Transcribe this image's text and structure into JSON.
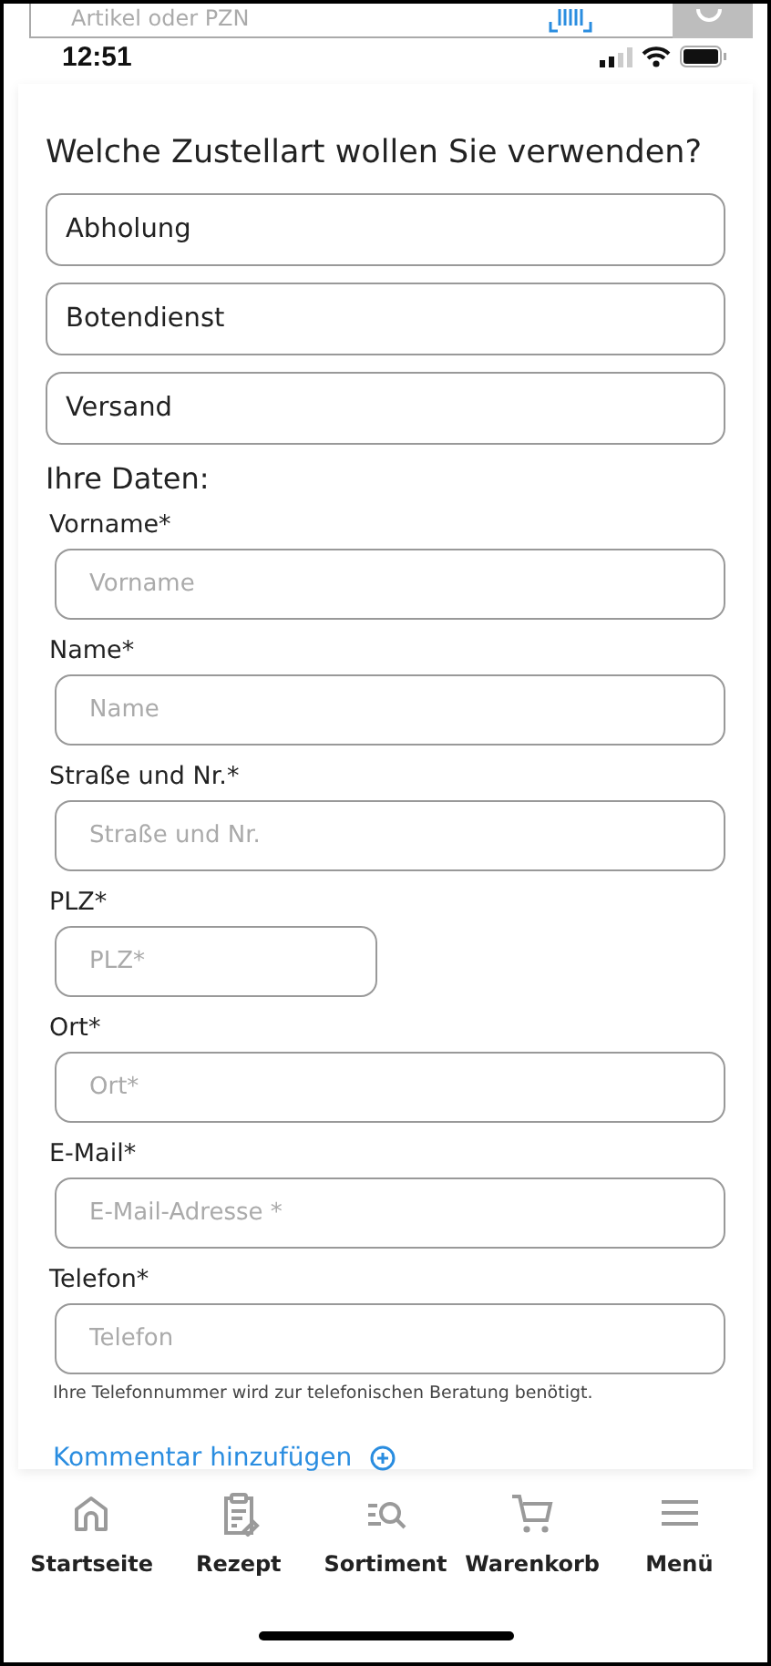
{
  "search": {
    "placeholder": "Artikel oder PZN"
  },
  "status_bar": {
    "time": "12:51"
  },
  "question": "Welche Zustellart wollen Sie verwenden?",
  "delivery_options": [
    {
      "label": "Abholung"
    },
    {
      "label": "Botendienst"
    },
    {
      "label": "Versand"
    }
  ],
  "section_title": "Ihre Daten:",
  "fields": [
    {
      "label": "Vorname*",
      "placeholder": "Vorname",
      "kind": "full"
    },
    {
      "label": "Name*",
      "placeholder": "Name",
      "kind": "full"
    },
    {
      "label": "Straße und Nr.*",
      "placeholder": "Straße und Nr.",
      "kind": "full"
    },
    {
      "label": "PLZ*",
      "placeholder": "PLZ*",
      "kind": "short"
    },
    {
      "label": "Ort*",
      "placeholder": "Ort*",
      "kind": "full"
    },
    {
      "label": "E-Mail*",
      "placeholder": "E-Mail-Adresse *",
      "kind": "full"
    },
    {
      "label": "Telefon*",
      "placeholder": "Telefon",
      "kind": "full"
    }
  ],
  "hint": "Ihre Telefonnummer wird zur telefonischen Beratung benötigt.",
  "comment_link": "Kommentar hinzufügen",
  "nav": [
    {
      "label": "Startseite"
    },
    {
      "label": "Rezept"
    },
    {
      "label": "Sortiment"
    },
    {
      "label": "Warenkorb"
    },
    {
      "label": "Menü"
    }
  ]
}
